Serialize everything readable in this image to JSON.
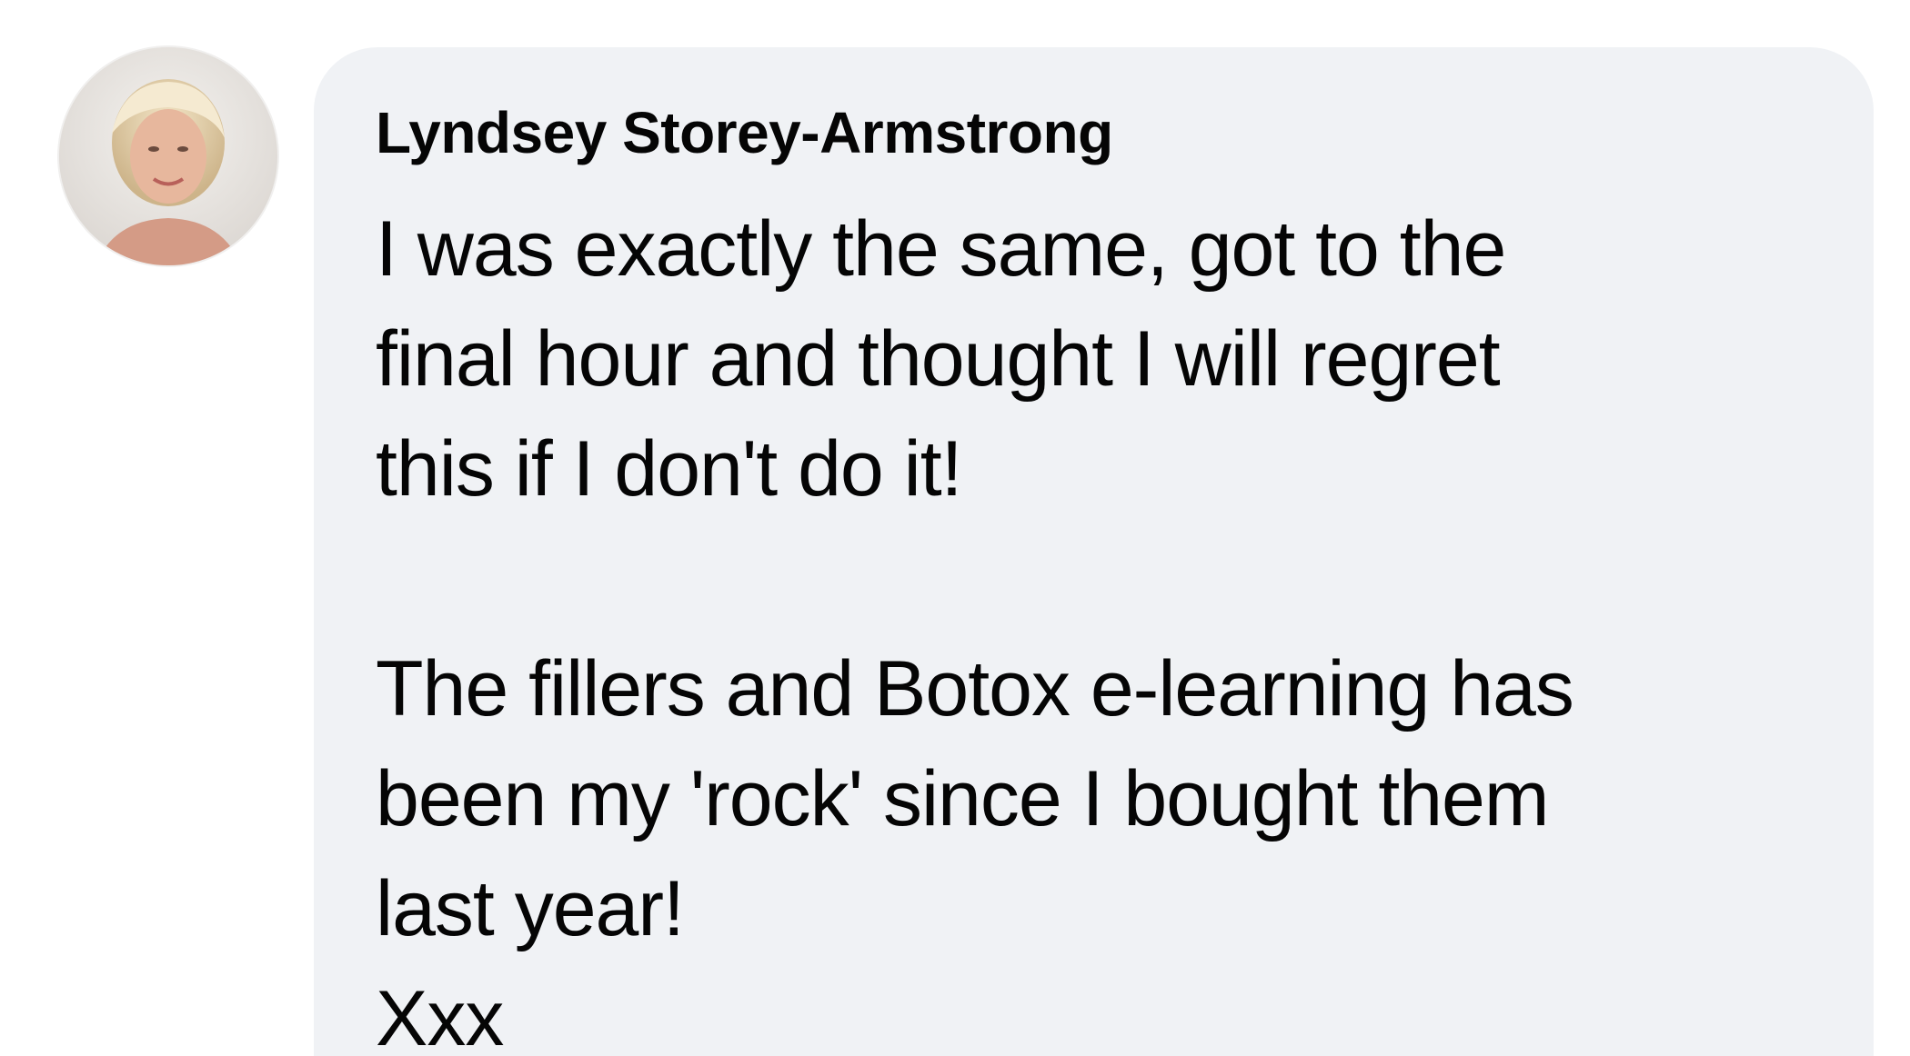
{
  "comment": {
    "author": "Lyndsey Storey-Armstrong",
    "text": "I was exactly the same, got to the\nfinal hour and thought I will regret\nthis if I don't do it!\n\nThe fillers and Botox e-learning has\nbeen my 'rock' since I bought them\nlast year!\nXxx"
  },
  "colors": {
    "bubble_bg": "#f0f2f5",
    "text": "#050505"
  },
  "icons": {
    "avatar": "profile-photo"
  }
}
